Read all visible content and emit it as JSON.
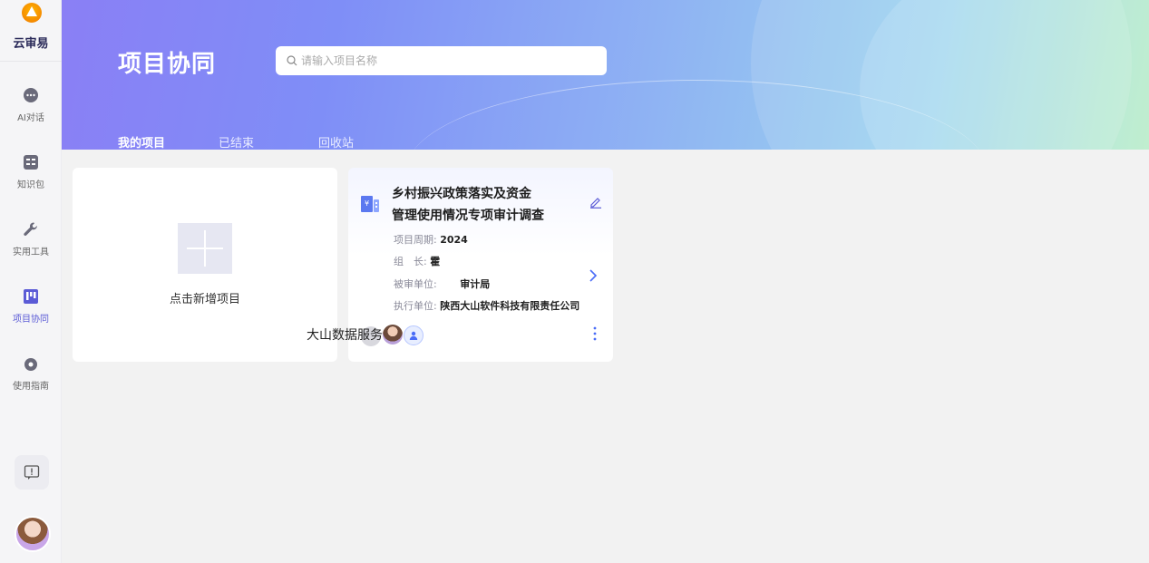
{
  "app": {
    "logo_text": "云审易"
  },
  "sidebar": {
    "items": [
      {
        "label": "AI对话",
        "icon": "chat-icon"
      },
      {
        "label": "知识包",
        "icon": "knowledge-icon"
      },
      {
        "label": "实用工具",
        "icon": "wrench-icon"
      },
      {
        "label": "项目协同",
        "icon": "kanban-icon",
        "active": true
      },
      {
        "label": "使用指南",
        "icon": "guide-icon"
      }
    ],
    "feedback_icon": "feedback-icon"
  },
  "header": {
    "title": "项目协同",
    "search_placeholder": "请输入项目名称",
    "tabs": [
      {
        "label": "我的项目",
        "active": true
      },
      {
        "label": "已结束"
      },
      {
        "label": "回收站"
      }
    ]
  },
  "new_project": {
    "label": "点击新增项目"
  },
  "project": {
    "title_line1": "乡村振兴政策落实及资金",
    "title_line2": "管理使用情况专项审计调查",
    "period_label": "项目周期:",
    "period_value": "2024",
    "leader_label": "组　长:",
    "leader_value": "霍",
    "audited_label": "被审单位:",
    "audited_value": "审计局",
    "executor_label": "执行单位:",
    "executor_value": "陕西大山软件科技有限责任公司",
    "member_name": "大山数据服务"
  },
  "colors": {
    "accent": "#5b5bd6",
    "link": "#4a6cf7"
  }
}
